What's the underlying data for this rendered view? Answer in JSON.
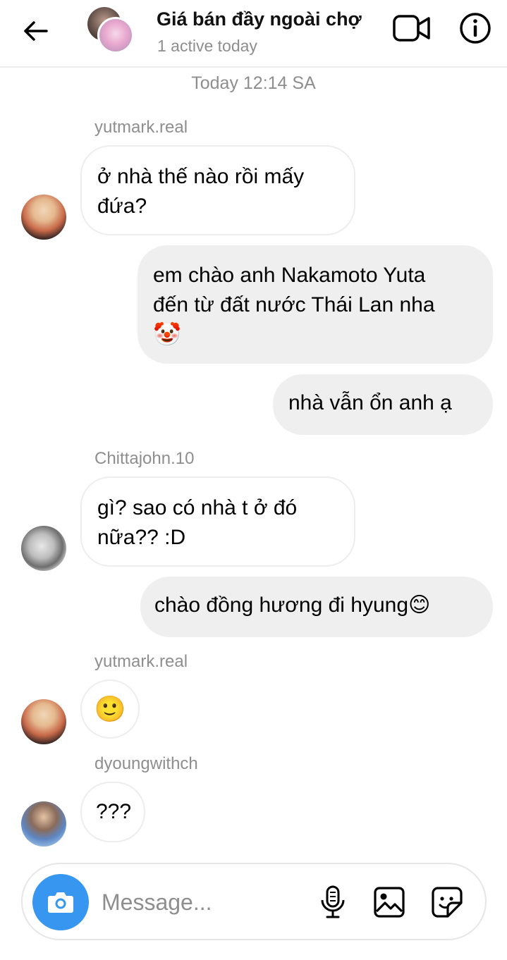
{
  "header": {
    "title": "Giá bán đầy ngoài chợ",
    "subtitle": "1 active today",
    "icons": {
      "back": "arrow-left-icon",
      "video": "video-call-icon",
      "info": "info-icon"
    }
  },
  "timestamp": "Today 12:14 SA",
  "messages": [
    {
      "sender": "yutmark.real",
      "text_line1": "ở nhà thế nào rồi mấy",
      "text_line2": "đứa?"
    },
    {
      "text_line1": "em chào anh Nakamoto Yuta",
      "text_line2": "đến từ đất nước Thái Lan nha",
      "emoji": "🤡"
    },
    {
      "text": "nhà vẫn ổn anh ạ"
    },
    {
      "sender": "Chittajohn.10",
      "text_line1": "gì? sao có nhà t ở đó",
      "text_line2": "nữa?? :D"
    },
    {
      "text": "chào đồng hương đi hyung",
      "emoji": "😊"
    },
    {
      "sender": "yutmark.real",
      "emoji": "🙂"
    },
    {
      "sender": "dyoungwithch",
      "text": "???"
    }
  ],
  "composer": {
    "placeholder": "Message...",
    "icons": {
      "camera": "camera-icon",
      "mic": "microphone-icon",
      "gallery": "gallery-icon",
      "sticker": "sticker-icon"
    }
  },
  "colors": {
    "accent": "#3797f0",
    "outgoing_bubble": "#efefef",
    "muted_text": "#8e8e8e"
  }
}
